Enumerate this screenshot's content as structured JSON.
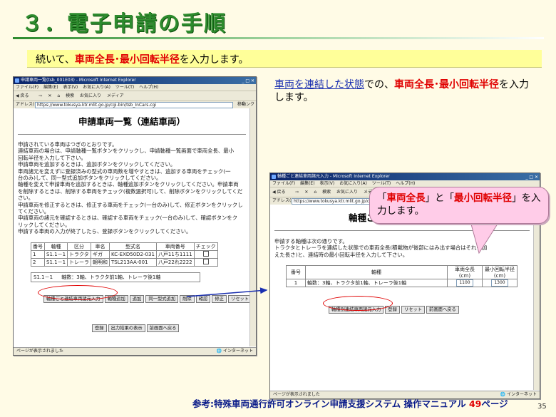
{
  "slide": {
    "title": "３．電子申請の手順",
    "subtitle_1": "続いて、",
    "subtitle_red": "車両全長･最小回転半径",
    "subtitle_2": "を入力します。",
    "right_note_link": "車両を連結した状態",
    "right_note_1": "での、",
    "right_note_red": "車両全長･最小回転半径",
    "right_note_2": "を入力します。",
    "callout_1": "「",
    "callout_red1": "車両全長",
    "callout_2": "」と「",
    "callout_red2": "最小回転半径",
    "callout_3": "」を入力します。",
    "footer_text": "参考:特殊車両通行許可オンライン申請支援システム 操作マニュアル ",
    "footer_page": "49",
    "footer_suffix": "ページ",
    "page_number": "35"
  },
  "browser": {
    "menu": [
      "ファイル(F)",
      "編集(E)",
      "表示(V)",
      "お気に入り(A)",
      "ツール(T)",
      "ヘルプ(H)"
    ],
    "toolbar": [
      "戻る",
      "⇨",
      "✕",
      "⌂",
      "検索",
      "お気に入り",
      "メディア"
    ],
    "address_label": "アドレス(D)",
    "go_label": "移動",
    "links_label": "リンク",
    "status_text": "ページが表示されました",
    "zone_text": "インターネット",
    "accent": "#0a246a"
  },
  "window1": {
    "title_bar": "申請車両一覧(tsb_001E03) - Microsoft Internet Explorer",
    "url": "https://www.tokusya.ktr.mlit.go.jp/cgi-bin/tsb_InCars.cgi",
    "page_title": "申請車両一覧（連結車両）",
    "instructions": [
      "申請されている車両はつぎのとおりです。",
      "連結車両の場合は、申請軸種一覧ボタンをクリックし、申請軸種一覧画面で車両全長、最小",
      "回転半径を入力して下さい。",
      "申請車両を追加するときは、追加ボタンをクリックしてください。",
      "車両諸元を変えずに登録済みの型式の車両数を増やすときは、追加する車両をチェック(一",
      "台のみ)して、同一型式追加ボタンをクリックしてください。",
      "軸種を変えて申請車両を追加するときは、軸種追加ボタンをクリックしてください。申請車両",
      "を削除するときは、削除する車両をチェック(複数選択可)して、削除ボタンをクリックしてくだ",
      "さい。",
      "申請車両を修正するときは、修正する車両をチェック(一台のみ)して、修正ボタンをクリックし",
      "てください。",
      "申請車両の諸元を確認するときは、確認する車両をチェック(一台のみ)して、確認ボタンをク",
      "リックしてください。",
      "申請する車両の入力が終了したら、登録ボタンをクリックしてください。"
    ],
    "table_headers": [
      "番号",
      "軸種",
      "区分",
      "車名",
      "型式名",
      "車両番号",
      "チェック"
    ],
    "rows": [
      {
        "no": "1",
        "axis": "S1.1－1",
        "kind": "トラクタ",
        "maker": "ギガ",
        "model": "KC-EXD50D2-031",
        "plate": "八戸11ち1111"
      },
      {
        "no": "2",
        "axis": "S1.1－1",
        "kind": "トレーラ",
        "maker": "朝明和",
        "model": "TSL213AA-001",
        "plate": "八戸22れ2222"
      }
    ],
    "axis_box_code": "S1.1－1",
    "axis_box_text": "軸数：3軸、トラクタ前1軸、トレーラ後1軸",
    "buttons": [
      "軸種ごと連結車両諸元入力",
      "軸種追加",
      "追加",
      "同一型式追加",
      "削除",
      "確認",
      "修正",
      "リセット"
    ],
    "buttons_bottom": [
      "登録",
      "出力結果の表示",
      "前画面へ戻る"
    ]
  },
  "window2": {
    "title_bar": "軸種ごと連結車両諸元入力 - Microsoft Internet Explorer",
    "url": "https://www.tokusya.ktr.mlit.go.jp/cgi-bin/tsb_InCars.cgi",
    "page_title": "軸種ごと連結車両諸元入力",
    "instructions": [
      "申請する軸種は次の通りです。",
      "トラクタとトレーラを連結した状態での車両全長(積載物が後部にはみ出す場合はそれも加",
      "えた長さ)と、連結時の最小回転半径を入力して下さい。"
    ],
    "table_headers": [
      "番号",
      "軸種",
      "車両全長(cm)",
      "最小回転半径(cm)"
    ],
    "row": {
      "no": "1",
      "axis": "軸数：3軸、トラクタ前1軸、トレーラ後1軸",
      "length": "1100",
      "radius": "1300"
    },
    "buttons": [
      "軸種別連結車両諸元入力",
      "登録",
      "リセット",
      "前画面へ戻る"
    ]
  }
}
